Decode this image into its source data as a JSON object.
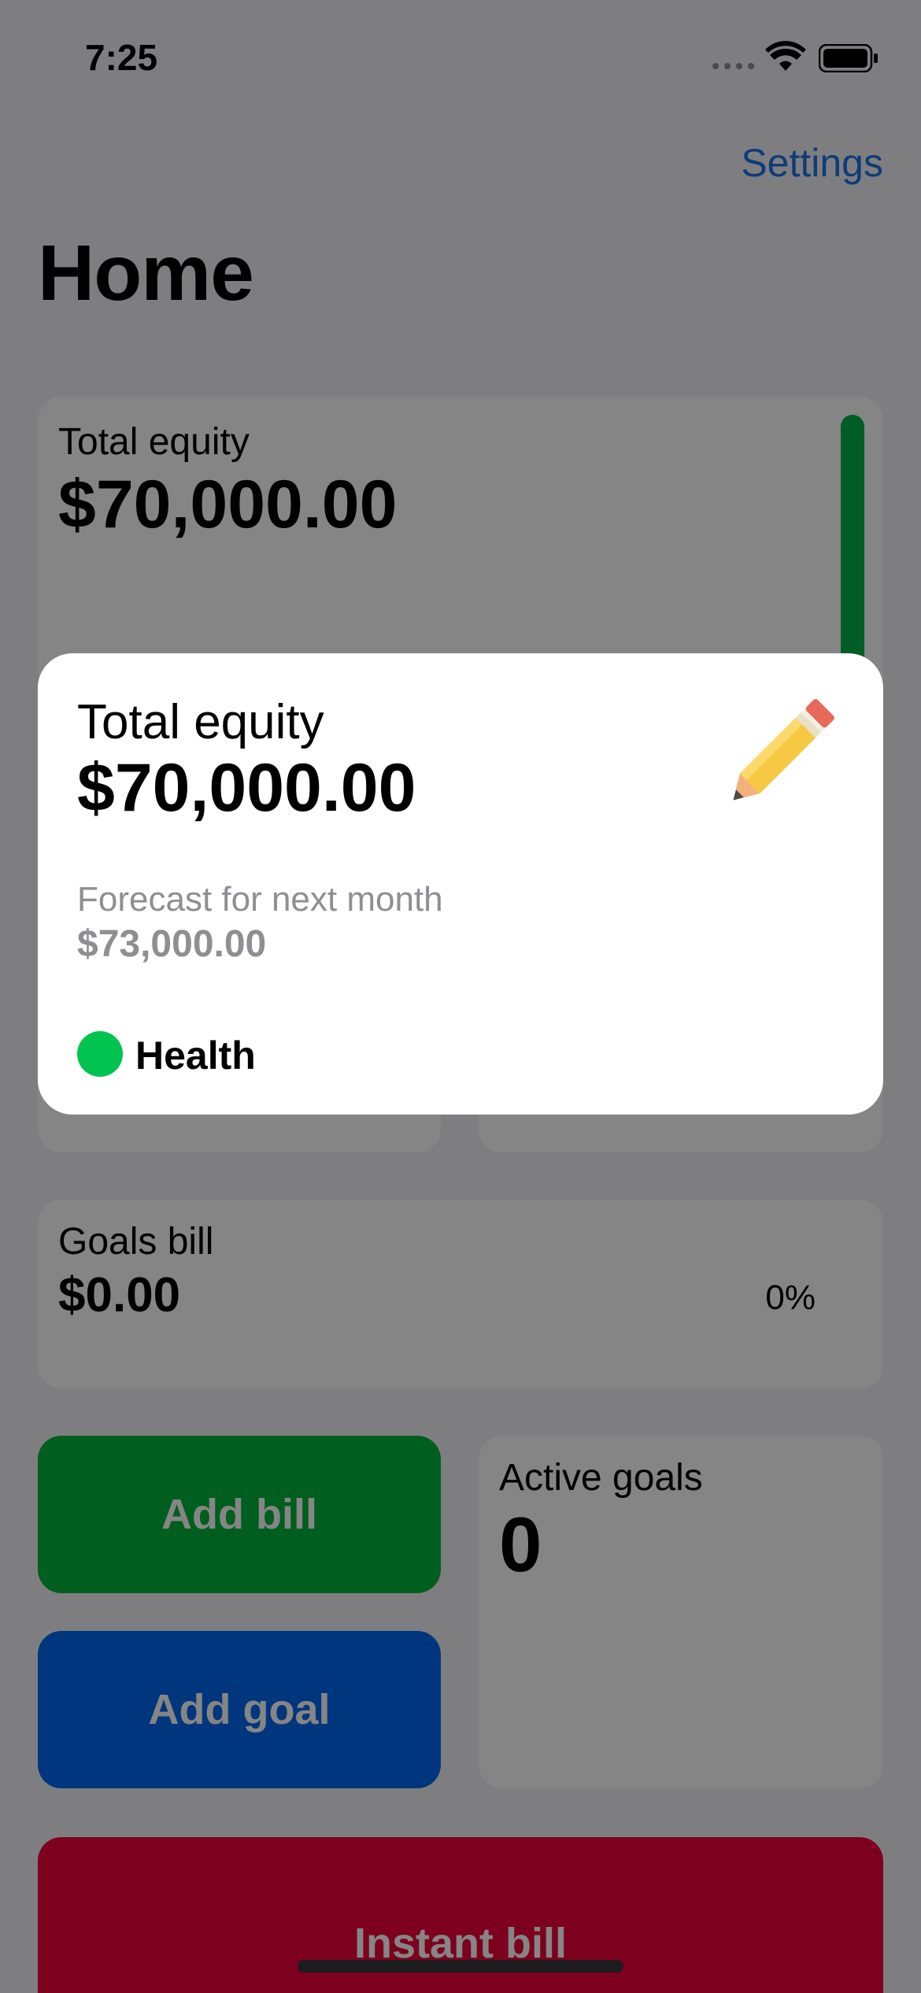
{
  "status_bar": {
    "time": "7:25"
  },
  "nav": {
    "settings_label": "Settings",
    "title": "Home"
  },
  "equity_card": {
    "label": "Total equity",
    "value": "$70,000.00",
    "bar_color": "#00b34a"
  },
  "goals_bill": {
    "label": "Goals bill",
    "value": "$0.00",
    "percent": "0%"
  },
  "buttons": {
    "add_bill": "Add bill",
    "add_goal": "Add goal",
    "instant_bill": "Instant bill"
  },
  "active_goals": {
    "label": "Active goals",
    "value": "0"
  },
  "popup": {
    "title": "Total equity",
    "value": "$70,000.00",
    "forecast_label": "Forecast for next month",
    "forecast_value": "$73,000.00",
    "health_label": "Health",
    "health_color": "#00c44f",
    "icon": "pencil-icon"
  },
  "colors": {
    "accent_blue": "#1a73e8",
    "add_bill": "#00b53a",
    "add_goal": "#0069f0",
    "instant_bill": "#f0003a"
  }
}
